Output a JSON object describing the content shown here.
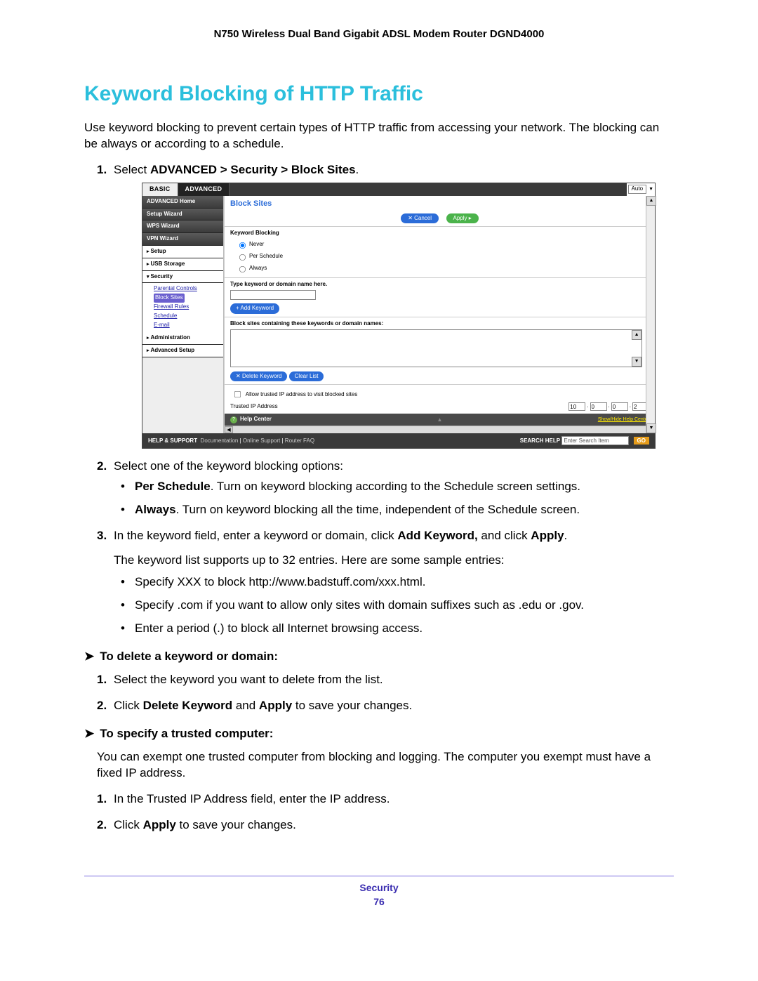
{
  "header": "N750 Wireless Dual Band Gigabit ADSL Modem Router DGND4000",
  "title": "Keyword Blocking of HTTP Traffic",
  "intro": "Use keyword blocking to prevent certain types of HTTP traffic from accessing your network. The blocking can be always or according to a schedule.",
  "steps": {
    "s1_pre": "Select ",
    "s1_bold": "ADVANCED > Security > Block Sites",
    "s1_post": ".",
    "s2": "Select one of the keyword blocking options:",
    "s2_b1_bold": "Per Schedule",
    "s2_b1_rest": ". Turn on keyword blocking according to the Schedule screen settings.",
    "s2_b2_bold": "Always",
    "s2_b2_rest": ". Turn on keyword blocking all the time, independent of the Schedule screen.",
    "s3_pre": "In the keyword field, enter a keyword or domain, click ",
    "s3_bold1": "Add Keyword,",
    "s3_mid": " and click ",
    "s3_bold2": "Apply",
    "s3_post": ".",
    "s3_after": "The keyword list supports up to 32 entries. Here are some sample entries:",
    "s3_b1": "Specify XXX to block http://www.badstuff.com/xxx.html.",
    "s3_b2": "Specify .com if you want to allow only sites with domain suffixes such as .edu or .gov.",
    "s3_b3": "Enter a period (.) to block all Internet browsing access."
  },
  "task1": {
    "head": "To delete a keyword or domain:",
    "s1": "Select the keyword you want to delete from the list.",
    "s2_pre": "Click ",
    "s2_b1": "Delete Keyword",
    "s2_mid": " and ",
    "s2_b2": "Apply",
    "s2_post": " to save your changes."
  },
  "task2": {
    "head": "To specify a trusted computer:",
    "intro": "You can exempt one trusted computer from blocking and logging. The computer you exempt must have a fixed IP address.",
    "s1": "In the Trusted IP Address field, enter the IP address.",
    "s2_pre": "Click ",
    "s2_b": "Apply",
    "s2_post": " to save your changes."
  },
  "footer": {
    "section": "Security",
    "page": "76"
  },
  "shot": {
    "tabs": {
      "basic": "BASIC",
      "advanced": "ADVANCED",
      "auto": "Auto"
    },
    "nav": {
      "home": "ADVANCED Home",
      "setupwiz": "Setup Wizard",
      "wps": "WPS Wizard",
      "vpn": "VPN Wizard",
      "setup": "Setup",
      "usb": "USB Storage",
      "security": "Security",
      "admin": "Administration",
      "advsetup": "Advanced Setup",
      "subs": {
        "parental": "Parental Controls",
        "block": "Block Sites",
        "firewall": "Firewall Rules",
        "schedule": "Schedule",
        "email": "E-mail"
      }
    },
    "main": {
      "title": "Block Sites",
      "cancel": "Cancel",
      "apply": "Apply",
      "kb_hdr": "Keyword Blocking",
      "opt_never": "Never",
      "opt_sched": "Per Schedule",
      "opt_always": "Always",
      "type_hdr": "Type keyword or domain name here.",
      "add_kw": "Add Keyword",
      "list_hdr": "Block sites containing these keywords or domain names:",
      "del_kw": "Delete Keyword",
      "clear": "Clear List",
      "allow_cb": "Allow trusted IP address to visit blocked sites",
      "trusted_lbl": "Trusted IP Address",
      "ip": [
        "10",
        "0",
        "0",
        "2"
      ],
      "hc": "Help Center",
      "hc_toggle": "Show/Hide Help Center"
    },
    "footer": {
      "hs": "HELP & SUPPORT",
      "doc": "Documentation",
      "online": "Online Support",
      "faq": "Router FAQ",
      "searchlbl": "SEARCH HELP",
      "searchph": "Enter Search Item",
      "go": "GO"
    }
  }
}
